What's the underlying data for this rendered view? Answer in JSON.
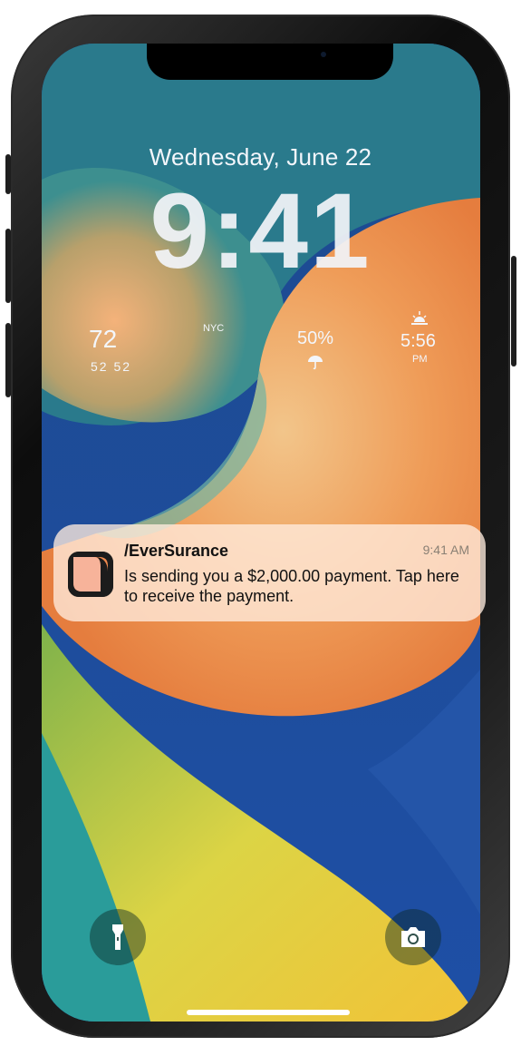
{
  "lock_screen": {
    "date": "Wednesday, June 22",
    "time": "9:41"
  },
  "widgets": {
    "temperature": "72",
    "high_low": "52 52",
    "city": "NYC",
    "rain_chance": "50%",
    "sunset_time": "5:56",
    "sunset_period": "PM"
  },
  "notification": {
    "app_name": "/EverSurance",
    "time": "9:41 AM",
    "message": "Is sending you a $2,000.00 payment. Tap here to receive the payment.",
    "icon": "eversurance-app-icon"
  },
  "quick_actions": {
    "left_icon": "flashlight-icon",
    "right_icon": "camera-icon"
  },
  "colors": {
    "wallpaper_blue": "#1d3f8f",
    "wallpaper_orange": "#f3a35c",
    "wallpaper_yellow": "#e8d94a",
    "wallpaper_teal": "#3fa3a0",
    "notification_bg": "#ffece0"
  }
}
